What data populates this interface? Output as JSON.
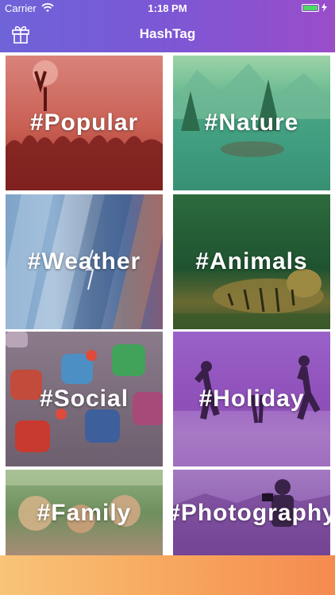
{
  "status_bar": {
    "carrier": "Carrier",
    "time": "1:18 PM",
    "battery_level": 1.0
  },
  "nav": {
    "title": "HashTag",
    "left_icon": "gift-icon"
  },
  "tiles": [
    {
      "label": "#Popular",
      "image": "concert-crowd"
    },
    {
      "label": "#Nature",
      "image": "mountain-lake"
    },
    {
      "label": "#Weather",
      "image": "sky-strips"
    },
    {
      "label": "#Animals",
      "image": "tiger-grass"
    },
    {
      "label": "#Social",
      "image": "app-icons"
    },
    {
      "label": "#Holiday",
      "image": "beach-jumping-people"
    },
    {
      "label": "#Family",
      "image": "family-outdoors"
    },
    {
      "label": "#Photography",
      "image": "photographer-landscape"
    }
  ],
  "colors": {
    "header_gradient_start": "#6f63d8",
    "header_gradient_end": "#9a4dc9",
    "bottom_gradient_start": "#f8c478",
    "bottom_gradient_end": "#f58a4f"
  }
}
